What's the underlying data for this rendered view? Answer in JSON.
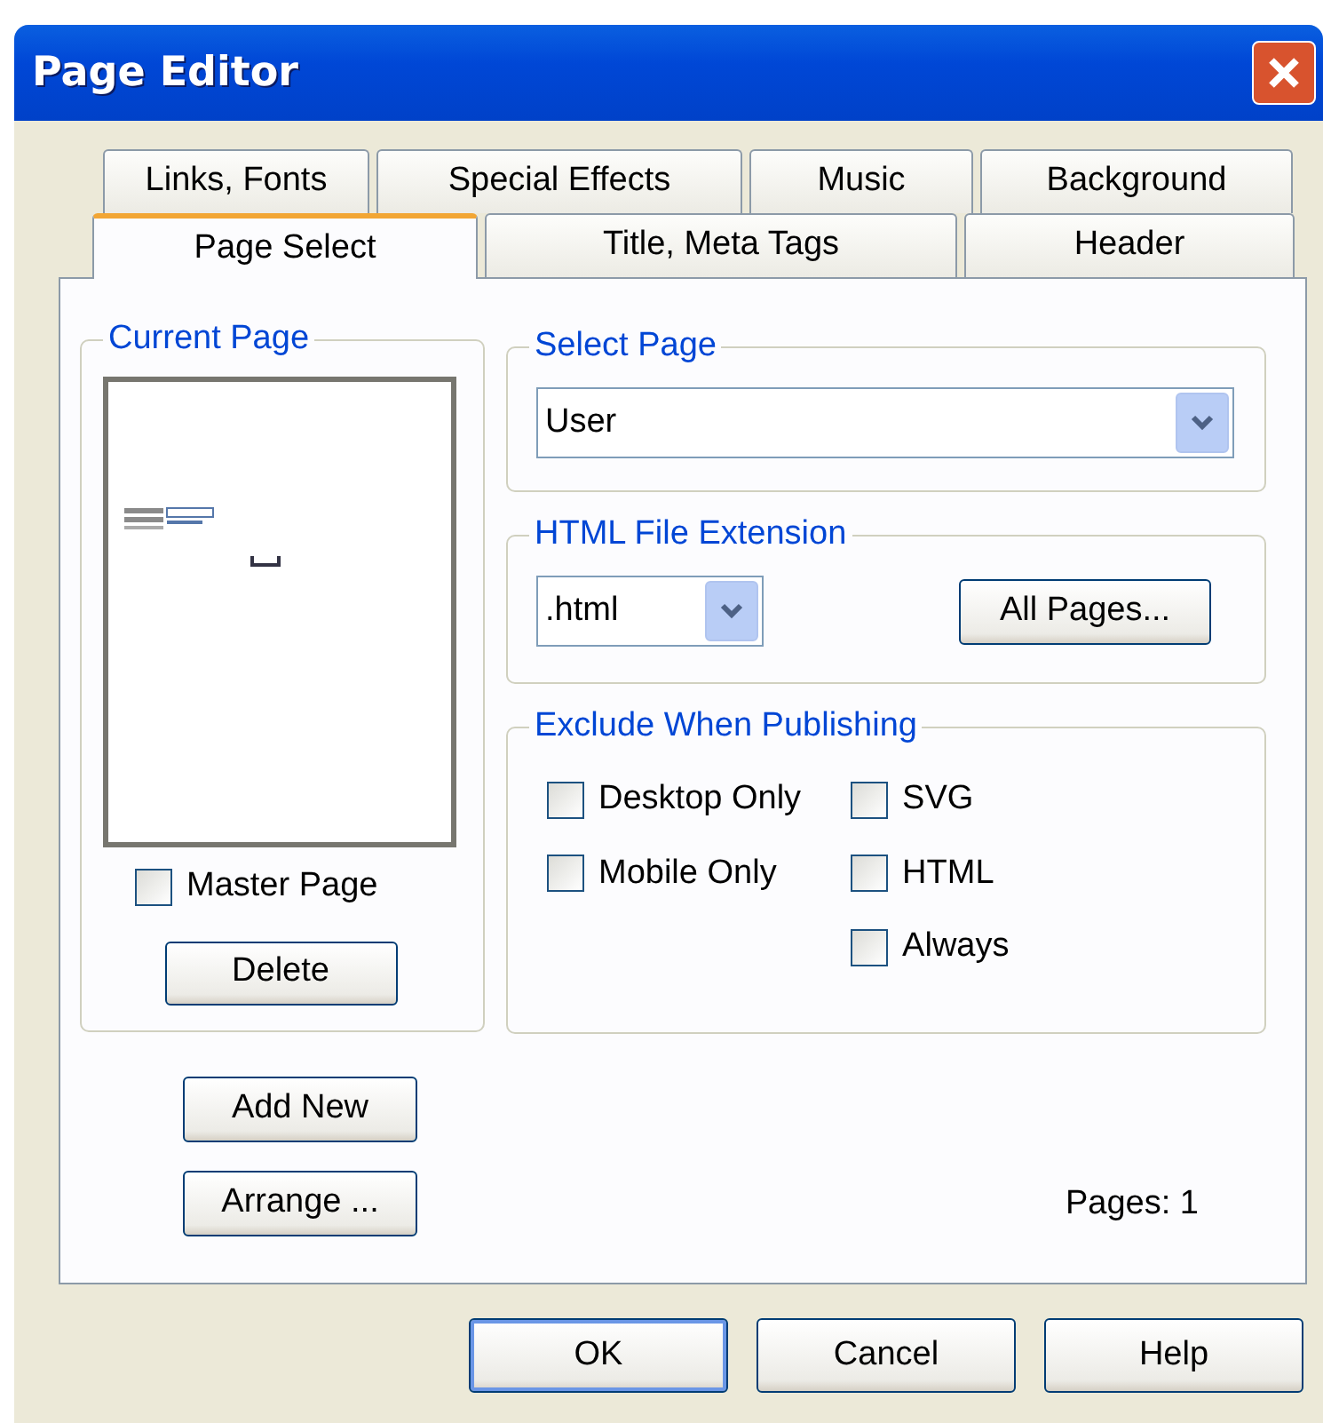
{
  "window": {
    "title": "Page Editor"
  },
  "tab_rows": [
    [
      {
        "label": "Links, Fonts",
        "selected": false
      },
      {
        "label": "Special Effects",
        "selected": false
      },
      {
        "label": "Music",
        "selected": false
      },
      {
        "label": "Background",
        "selected": false
      }
    ],
    [
      {
        "label": "Page Select",
        "selected": true
      },
      {
        "label": "Title, Meta Tags",
        "selected": false
      },
      {
        "label": "Header",
        "selected": false
      }
    ]
  ],
  "current_page": {
    "title": "Current Page",
    "master_page": {
      "label": "Master Page",
      "checked": false
    },
    "delete_button": "Delete"
  },
  "select_page": {
    "title": "Select Page",
    "value": "User"
  },
  "html_file_extension": {
    "title": "HTML File Extension",
    "value": ".html",
    "button": "All Pages..."
  },
  "exclude_when_publishing": {
    "title": "Exclude When Publishing",
    "columns": [
      [
        {
          "label": "Desktop Only",
          "checked": false
        },
        {
          "label": "Mobile Only",
          "checked": false
        }
      ],
      [
        {
          "label": "SVG",
          "checked": false
        },
        {
          "label": "HTML",
          "checked": false
        },
        {
          "label": "Always",
          "checked": false
        }
      ]
    ]
  },
  "side_buttons": [
    "Add New",
    "Arrange ..."
  ],
  "pages_count": "Pages: 1",
  "footer_buttons": [
    {
      "label": "OK",
      "default": true
    },
    {
      "label": "Cancel",
      "default": false
    },
    {
      "label": "Help",
      "default": false
    }
  ]
}
